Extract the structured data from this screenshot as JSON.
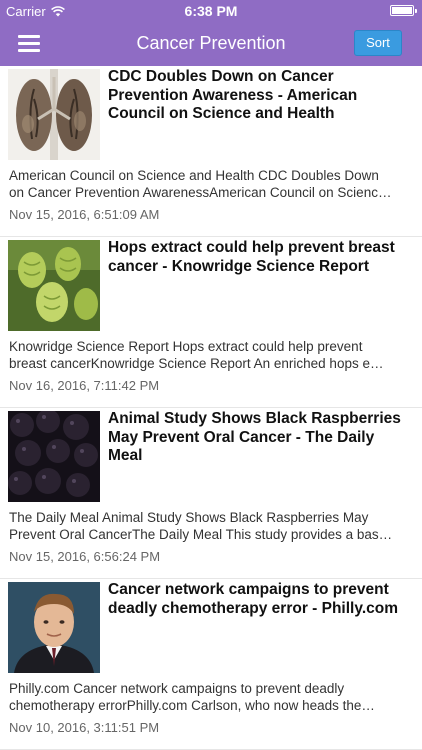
{
  "status_bar": {
    "carrier": "Carrier",
    "time": "6:38 PM"
  },
  "nav": {
    "title": "Cancer Prevention",
    "sort_label": "Sort"
  },
  "articles": [
    {
      "headline": "CDC Doubles Down on Cancer Prevention Awareness - American Council on Science and Health",
      "summary_line1": "American Council on Science and Health    CDC Doubles Down",
      "summary_line2": "on Cancer Prevention AwarenessAmerican Council on Scienc…",
      "date": "Nov 15, 2016, 6:51:09 AM",
      "thumb": "lungs-xray"
    },
    {
      "headline": "Hops extract could help prevent breast cancer - Knowridge Science Report",
      "summary_line1": "Knowridge Science Report    Hops extract could help prevent",
      "summary_line2": "breast cancerKnowridge Science Report  An enriched hops e…",
      "date": "Nov 16, 2016, 7:11:42 PM",
      "thumb": "hops"
    },
    {
      "headline": "Animal Study Shows Black Raspberries May Prevent Oral Cancer - The Daily Meal",
      "summary_line1": "The Daily Meal    Animal Study Shows Black Raspberries May",
      "summary_line2": "Prevent Oral CancerThe Daily Meal  This study provides a bas…",
      "date": "Nov 15, 2016, 6:56:24 PM",
      "thumb": "black-raspberries"
    },
    {
      "headline": "Cancer network campaigns to prevent deadly chemotherapy error - Philly.com",
      "summary_line1": "Philly.com    Cancer network campaigns to prevent deadly",
      "summary_line2": "chemotherapy errorPhilly.com  Carlson, who now heads the…",
      "date": "Nov 10, 2016, 3:11:51 PM",
      "thumb": "portrait"
    }
  ],
  "colors": {
    "nav_bg": "#8f6cc4",
    "sort_bg": "#3a9be0"
  }
}
